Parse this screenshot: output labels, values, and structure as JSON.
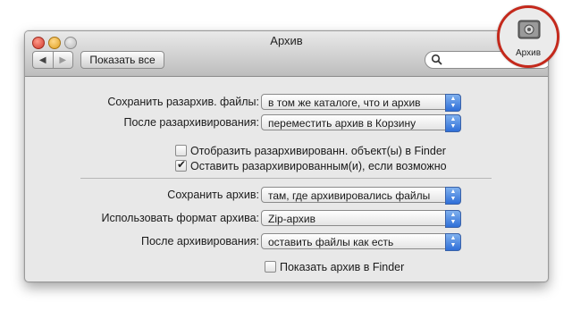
{
  "window": {
    "title": "Архив",
    "show_all": "Показать все",
    "nav_back": "◀",
    "nav_forward": "▶"
  },
  "badge": {
    "label": "Архив",
    "icon": "archive-utility-icon"
  },
  "unarchive": {
    "save_label": "Сохранить разархив. файлы:",
    "save_value": "в том же каталоге, что и архив",
    "after_label": "После разархивирования:",
    "after_value": "переместить архив в Корзину",
    "reveal_label": "Отобразить разархивированн. объект(ы) в Finder",
    "reveal_checked": false,
    "keep_label": "Оставить разархивированным(и), если возможно",
    "keep_checked": true
  },
  "archive": {
    "save_label": "Сохранить архив:",
    "save_value": "там, где архивировались файлы",
    "format_label": "Использовать формат архива:",
    "format_value": "Zip-архив",
    "after_label": "После архивирования:",
    "after_value": "оставить файлы как есть",
    "reveal_label": "Показать архив в Finder",
    "reveal_checked": false
  },
  "colors": {
    "accent": "#2f6fd8",
    "highlight_ring": "#c4291c"
  }
}
